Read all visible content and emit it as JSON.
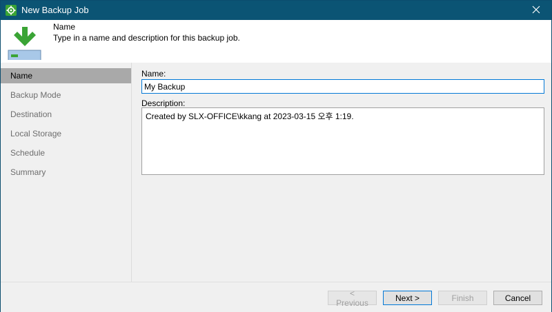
{
  "window": {
    "title": "New Backup Job"
  },
  "header": {
    "title": "Name",
    "description": "Type in a name and description for this backup job."
  },
  "sidebar": {
    "items": [
      {
        "label": "Name"
      },
      {
        "label": "Backup Mode"
      },
      {
        "label": "Destination"
      },
      {
        "label": "Local Storage"
      },
      {
        "label": "Schedule"
      },
      {
        "label": "Summary"
      }
    ]
  },
  "form": {
    "name_label": "Name:",
    "name_value": "My Backup",
    "description_label": "Description:",
    "description_value": "Created by SLX-OFFICE\\kkang at 2023-03-15 오후 1:19."
  },
  "buttons": {
    "previous": "< Previous",
    "next": "Next >",
    "finish": "Finish",
    "cancel": "Cancel"
  },
  "colors": {
    "titlebar": "#0b5474",
    "accent": "#0078d7",
    "active_step": "#a9a9a9",
    "icon_green": "#3aa435"
  },
  "icons": {
    "app": "gear-icon",
    "header": "download-to-disk-icon",
    "close": "close-icon"
  }
}
